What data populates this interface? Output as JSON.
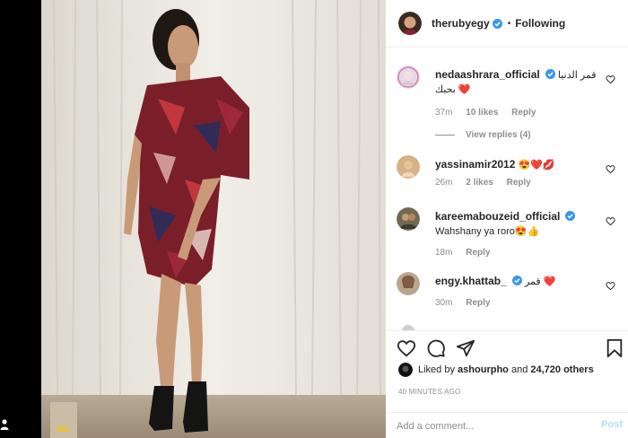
{
  "header": {
    "username": "therubyegy",
    "verified": true,
    "separator": "•",
    "follow_status": "Following"
  },
  "comments": [
    {
      "username": "nedaashrara_official",
      "verified": true,
      "text": "قمر الدنيا بحبك",
      "emoji": "❤️",
      "time": "37m",
      "likes": "10 likes",
      "reply": "Reply"
    },
    {
      "username": "yassinamir2012",
      "verified": false,
      "text": "",
      "emoji": "😍❤️💋",
      "time": "26m",
      "likes": "2 likes",
      "reply": "Reply"
    },
    {
      "username": "kareemabouzeid_official",
      "verified": true,
      "text": "Wahshany ya roro",
      "emoji": "😍👍",
      "time": "18m",
      "likes": "",
      "reply": "Reply"
    },
    {
      "username": "engy.khattab_",
      "verified": true,
      "text": "قمر",
      "emoji": "❤️",
      "time": "30m",
      "likes": "",
      "reply": "Reply"
    }
  ],
  "view_replies": "View replies (4)",
  "liked_by": {
    "prefix": "Liked by",
    "user": "ashourpho",
    "and": "and",
    "others": "24,720 others"
  },
  "posted_ago": "40 MINUTES AGO",
  "add_comment": {
    "placeholder": "Add a comment...",
    "post_label": "Post"
  },
  "icons": [
    "heart-icon",
    "comment-icon",
    "share-icon",
    "bookmark-icon",
    "verified-badge-icon"
  ],
  "colors": {
    "verified": "#3897f0",
    "like_red": "#ed4956",
    "post_disabled": "#b3dbff",
    "muted_text": "#8e8e8e"
  }
}
